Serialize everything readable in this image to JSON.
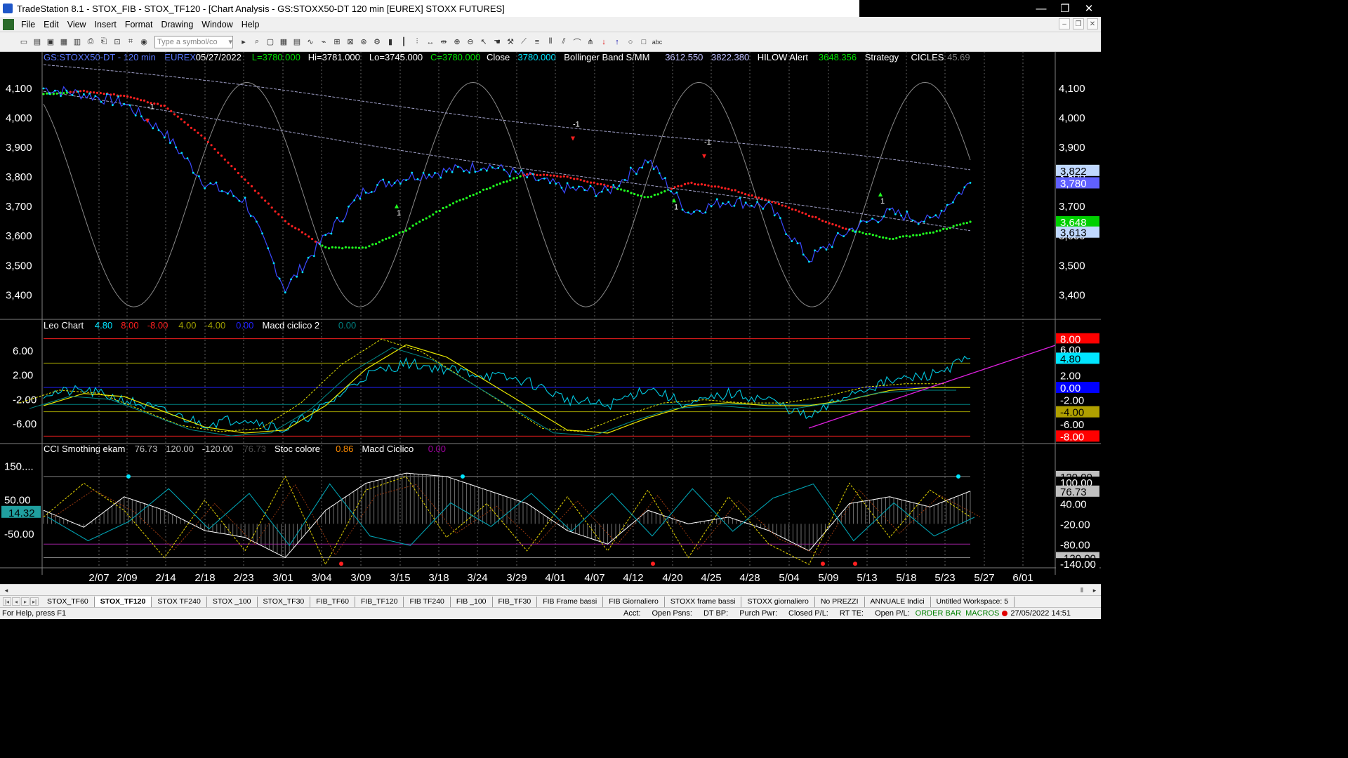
{
  "window": {
    "title": "TradeStation 8.1 - STOX_FIB - STOX_TF120 - [Chart Analysis - GS:STOXX50-DT  120 min  [EUREX] STOXX FUTURES]",
    "controls": [
      "—",
      "❐",
      "✕"
    ]
  },
  "menu": [
    "File",
    "Edit",
    "View",
    "Insert",
    "Format",
    "Drawing",
    "Window",
    "Help"
  ],
  "toolbar": {
    "symbol_placeholder": "Type a symbol/co"
  },
  "price_panel": {
    "header": [
      {
        "t": "GS:STOXX50-DT - 120 min",
        "c": "#5a78ff"
      },
      {
        "t": "EUREX",
        "c": "#5a78ff"
      },
      {
        "t": "05/27/2022",
        "c": "#ffffff"
      },
      {
        "t": "L=3780.000",
        "c": "#00e000"
      },
      {
        "t": "Hi=3781.000",
        "c": "#ffffff"
      },
      {
        "t": "Lo=3745.000",
        "c": "#ffffff"
      },
      {
        "t": "C=3780.000",
        "c": "#00e000"
      },
      {
        "t": "Close",
        "c": "#ffffff"
      },
      {
        "t": "3780.000",
        "c": "#00e5ff"
      },
      {
        "t": "Bollinger Band S/MM",
        "c": "#ffffff"
      },
      {
        "t": "3612.550",
        "c": "#c0c0ff"
      },
      {
        "t": "3822.380",
        "c": "#c0c0ff"
      },
      {
        "t": "HILOW Alert",
        "c": "#ffffff"
      },
      {
        "t": "3648.356",
        "c": "#00e000"
      },
      {
        "t": "Strategy",
        "c": "#ffffff"
      },
      {
        "t": "CICLES",
        "c": "#ffffff"
      },
      {
        "t": "45.69",
        "c": "#808080"
      }
    ],
    "yticks": [
      "4,100",
      "4,000",
      "3,900",
      "3,800",
      "3,700",
      "3,600",
      "3,500",
      "3,400"
    ],
    "right_labels": [
      {
        "t": "3,822",
        "v": 3822,
        "bg": "#c0d8ff",
        "fg": "#000"
      },
      {
        "t": "3,780",
        "v": 3780,
        "bg": "#6060ff",
        "fg": "#fff"
      },
      {
        "t": "3,648",
        "v": 3648,
        "bg": "#00d000",
        "fg": "#fff"
      },
      {
        "t": "3,613",
        "v": 3613,
        "bg": "#c0d8ff",
        "fg": "#000"
      }
    ],
    "markers": [
      {
        "t": "-1",
        "color": "#ffffff"
      },
      {
        "t": "1",
        "color": "#ffffff"
      },
      {
        "t": "-1",
        "color": "#ffffff"
      },
      {
        "t": "1",
        "color": "#ffffff"
      },
      {
        "t": "-1",
        "color": "#ffffff"
      },
      {
        "t": "1",
        "color": "#ffffff"
      }
    ]
  },
  "leo_panel": {
    "header": [
      {
        "t": "Leo Chart",
        "c": "#ffffff"
      },
      {
        "t": "4.80",
        "c": "#00e5ff"
      },
      {
        "t": "8.00",
        "c": "#ff2020"
      },
      {
        "t": "-8.00",
        "c": "#ff2020"
      },
      {
        "t": "4.00",
        "c": "#a0a000"
      },
      {
        "t": "-4.00",
        "c": "#a0a000"
      },
      {
        "t": "0.00",
        "c": "#2020ff"
      },
      {
        "t": "Macd ciclico 2",
        "c": "#ffffff"
      },
      {
        "t": "0.00",
        "c": "#008080"
      }
    ],
    "yticks": [
      "6.00",
      "2.00",
      "-2.00",
      "-6.00"
    ],
    "right_labels": [
      {
        "t": "8.00",
        "v": 8,
        "bg": "#ff0000",
        "fg": "#fff"
      },
      {
        "t": "6.00",
        "v": 6.3,
        "bg": "#000",
        "fg": "#fff"
      },
      {
        "t": "4.80",
        "v": 4.8,
        "bg": "#00e5ff",
        "fg": "#000"
      },
      {
        "t": "2.00",
        "v": 2,
        "bg": "#000",
        "fg": "#fff"
      },
      {
        "t": "0.00",
        "v": 0,
        "bg": "#0000ff",
        "fg": "#fff"
      },
      {
        "t": "-2.00",
        "v": -2,
        "bg": "#000",
        "fg": "#fff"
      },
      {
        "t": "-4.00",
        "v": -4,
        "bg": "#b0a000",
        "fg": "#000"
      },
      {
        "t": "-6.00",
        "v": -6,
        "bg": "#000",
        "fg": "#fff"
      },
      {
        "t": "-8.00",
        "v": -8,
        "bg": "#ff0000",
        "fg": "#fff"
      }
    ]
  },
  "cci_panel": {
    "header": [
      {
        "t": "CCI Smothing ekam",
        "c": "#ffffff"
      },
      {
        "t": "76.73",
        "c": "#c0c0c0"
      },
      {
        "t": "120.00",
        "c": "#c0c0c0"
      },
      {
        "t": "-120.00",
        "c": "#c0c0c0"
      },
      {
        "t": "76.73",
        "c": "#505050"
      },
      {
        "t": "Stoc colore",
        "c": "#ffffff"
      },
      {
        "t": "0.86",
        "c": "#ff8c00"
      },
      {
        "t": "Macd Ciclico",
        "c": "#ffffff"
      },
      {
        "t": "0.00",
        "c": "#a000a0"
      }
    ],
    "yticks": [
      "150....",
      "50.00",
      "-50.00"
    ],
    "left_label": "14.32",
    "right_labels": [
      {
        "t": "120.00",
        "v": 120,
        "bg": "#c0c0c0",
        "fg": "#000"
      },
      {
        "t": "100.00",
        "v": 103,
        "bg": "#000",
        "fg": "#fff"
      },
      {
        "t": "76.73",
        "v": 76.73,
        "bg": "#c0c0c0",
        "fg": "#000"
      },
      {
        "t": "40.00",
        "v": 40,
        "bg": "#000",
        "fg": "#fff"
      },
      {
        "t": "-20.00",
        "v": -20,
        "bg": "#000",
        "fg": "#fff"
      },
      {
        "t": "-80.00",
        "v": -80,
        "bg": "#000",
        "fg": "#fff"
      },
      {
        "t": "-120.00",
        "v": -120,
        "bg": "#c0c0c0",
        "fg": "#000"
      },
      {
        "t": "-140.00",
        "v": -138,
        "bg": "#000",
        "fg": "#fff"
      }
    ]
  },
  "xaxis": [
    "2/07",
    "2/09",
    "2/14",
    "2/18",
    "2/23",
    "3/01",
    "3/04",
    "3/09",
    "3/15",
    "3/18",
    "3/24",
    "3/29",
    "4/01",
    "4/07",
    "4/12",
    "4/20",
    "4/25",
    "4/28",
    "5/04",
    "5/09",
    "5/13",
    "5/18",
    "5/23",
    "5/27",
    "6/01"
  ],
  "tabs": [
    "STOX_TF60",
    "STOX_TF120",
    "STOX TF240",
    "STOX _100",
    "STOX_TF30",
    "FIB_TF60",
    "FIB_TF120",
    "FIB TF240",
    "FIB _100",
    "FIB_TF30",
    "FIB Frame bassi",
    "FIB Giornaliero",
    "STOXX frame bassi",
    "STOXX giornaliero",
    "No PREZZI",
    "ANNUALE Indici",
    "Untitled Workspace: 5"
  ],
  "active_tab": "STOX_TF120",
  "status": {
    "help": "For Help, press F1",
    "fields": [
      "Acct:",
      "Open Psns:",
      "DT BP:",
      "Purch Pwr:",
      "Closed P/L:",
      "RT TE:",
      "Open P/L:"
    ],
    "order_bar": "ORDER BAR",
    "macros": "MACROS",
    "datetime": "27/05/2022 14:51"
  },
  "chart_data": [
    {
      "type": "line",
      "title": "GS:STOXX50-DT - 120 min",
      "x": [
        "2/07",
        "2/09",
        "2/14",
        "2/18",
        "2/23",
        "3/01",
        "3/04",
        "3/09",
        "3/15",
        "3/18",
        "3/24",
        "3/29",
        "4/01",
        "4/07",
        "4/12",
        "4/20",
        "4/25",
        "4/28",
        "5/04",
        "5/09",
        "5/13",
        "5/18",
        "5/23",
        "5/27"
      ],
      "series": [
        {
          "name": "Close",
          "values": [
            4100,
            4080,
            4050,
            3950,
            3780,
            3720,
            3420,
            3600,
            3760,
            3800,
            3820,
            3840,
            3800,
            3760,
            3750,
            3860,
            3680,
            3720,
            3700,
            3520,
            3620,
            3680,
            3650,
            3780
          ]
        },
        {
          "name": "HILOW Alert",
          "values": [
            4080,
            4090,
            4075,
            4040,
            3930,
            3790,
            3650,
            3560,
            3560,
            3620,
            3700,
            3760,
            3810,
            3800,
            3770,
            3730,
            3780,
            3760,
            3720,
            3670,
            3620,
            3590,
            3610,
            3648
          ]
        }
      ],
      "ylim": [
        3320,
        4190
      ]
    },
    {
      "type": "line",
      "title": "Leo Chart",
      "x": [
        "2/07",
        "2/09",
        "2/14",
        "2/18",
        "2/23",
        "3/01",
        "3/04",
        "3/09",
        "3/15",
        "3/18",
        "3/24",
        "3/29",
        "4/01",
        "4/07",
        "4/12",
        "4/20",
        "4/25",
        "4/28",
        "5/04",
        "5/09",
        "5/13",
        "5/18",
        "5/23",
        "5/27"
      ],
      "series": [
        {
          "name": "Leo Chart",
          "values": [
            -1,
            -0.5,
            -2,
            -4,
            -6,
            -5,
            -7,
            -3,
            2,
            4,
            3,
            2,
            1,
            -2,
            -3,
            0,
            -3,
            -1,
            -2,
            -5,
            -1,
            1,
            2,
            4.8
          ]
        },
        {
          "name": "Macd ciclico 2",
          "values": [
            -3,
            -1,
            -1.5,
            -4,
            -6.5,
            -7.5,
            -7,
            -3,
            3,
            7,
            5,
            1,
            -3,
            -7,
            -7.5,
            -5,
            -3,
            -2.5,
            -3,
            -3,
            -2,
            -0.5,
            0,
            0
          ]
        }
      ],
      "ylim": [
        -9,
        9
      ]
    },
    {
      "type": "line",
      "title": "CCI Smothing ekam",
      "x": [
        "2/07",
        "2/09",
        "2/14",
        "2/18",
        "2/23",
        "3/01",
        "3/04",
        "3/09",
        "3/15",
        "3/18",
        "3/24",
        "3/29",
        "4/01",
        "4/07",
        "4/12",
        "4/20",
        "4/25",
        "4/28",
        "5/04",
        "5/09",
        "5/13",
        "5/18",
        "5/23",
        "5/27"
      ],
      "series": [
        {
          "name": "CCI Smothing ekam",
          "values": [
            20,
            -30,
            60,
            20,
            -40,
            -60,
            -120,
            20,
            100,
            130,
            120,
            80,
            40,
            -40,
            -80,
            20,
            -20,
            0,
            -40,
            -100,
            40,
            60,
            30,
            76.73
          ]
        },
        {
          "name": "Stoc colore",
          "values": [
            0,
            100,
            20,
            -120,
            50,
            -100,
            120,
            -140,
            80,
            120,
            -60,
            40,
            -100,
            60,
            -100,
            80,
            -120,
            60,
            -80,
            -140,
            100,
            -60,
            80,
            0.86
          ]
        }
      ],
      "ylim": [
        -150,
        180
      ]
    }
  ]
}
